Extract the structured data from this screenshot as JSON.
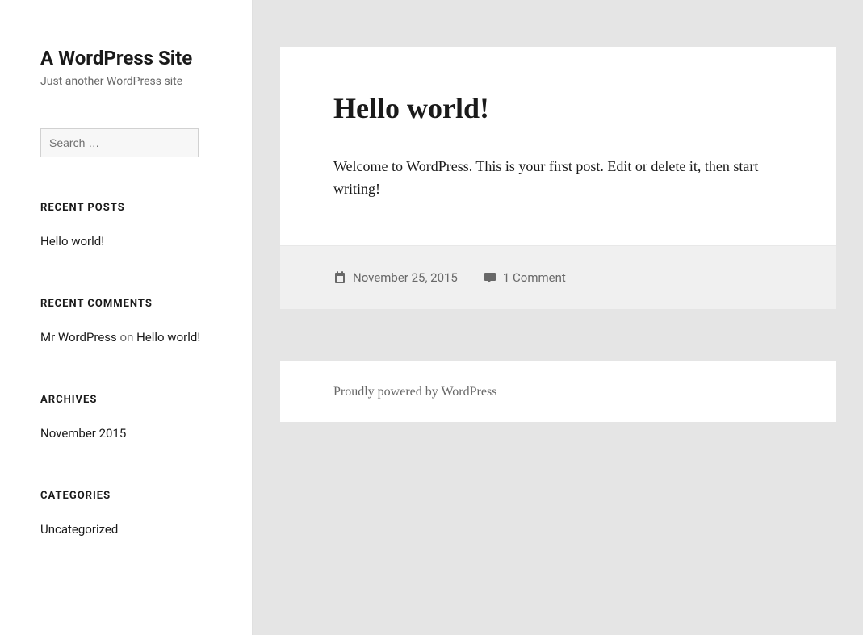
{
  "site": {
    "title": "A WordPress Site",
    "tagline": "Just another WordPress site"
  },
  "search": {
    "placeholder": "Search …"
  },
  "widgets": {
    "recent_posts": {
      "title": "RECENT POSTS",
      "items": [
        "Hello world!"
      ]
    },
    "recent_comments": {
      "title": "RECENT COMMENTS",
      "items": [
        {
          "author": "Mr WordPress",
          "on": " on ",
          "post": "Hello world!"
        }
      ]
    },
    "archives": {
      "title": "ARCHIVES",
      "items": [
        "November 2015"
      ]
    },
    "categories": {
      "title": "CATEGORIES",
      "items": [
        "Uncategorized"
      ]
    }
  },
  "post": {
    "title": "Hello world!",
    "body": "Welcome to WordPress. This is your first post. Edit or delete it, then start writing!",
    "date": "November 25, 2015",
    "comments": "1 Comment"
  },
  "footer": {
    "text": "Proudly powered by WordPress"
  }
}
